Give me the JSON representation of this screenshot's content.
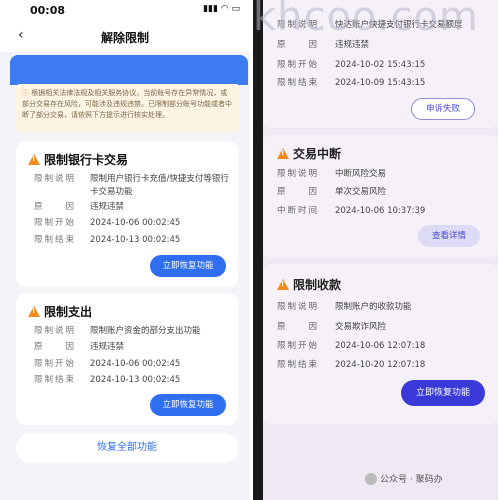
{
  "left": {
    "status_time": "00:08",
    "nav_title": "解除限制",
    "back_icon": "‹",
    "notice": "根据相关法律法规及相关服务协议，当前账号存在异常情况，或部分交易存在风险，可能涉及违规违禁。已限制部分账号功能或者中断了部分交易，请依照下方提示进行核实处理。",
    "card1": {
      "title": "限制银行卡交易",
      "rows": [
        {
          "k": "限制说明",
          "v": "限制用户银行卡充值/快捷支付等银行"
        },
        {
          "k": "",
          "v": "卡交易功能"
        },
        {
          "k": "原　　因",
          "v": "违规违禁"
        },
        {
          "k": "限制开始",
          "v": "2024-10-06 00:02:45"
        },
        {
          "k": "限制结束",
          "v": "2024-10-13 00:02:45"
        }
      ],
      "button": "立即恢复功能"
    },
    "card2": {
      "title": "限制支出",
      "rows": [
        {
          "k": "限制说明",
          "v": "限制账户资金的部分支出功能"
        },
        {
          "k": "原　　因",
          "v": "违规违禁"
        },
        {
          "k": "限制开始",
          "v": "2024-10-06 00:02:45"
        },
        {
          "k": "限制结束",
          "v": "2024-10-13 00:02:45"
        }
      ],
      "button": "立即恢复功能"
    },
    "restore_all": "恢复全部功能"
  },
  "right": {
    "watermark": "khcoo.com",
    "top_card": {
      "rows": [
        {
          "k": "限制说明",
          "v": "快达账户快捷支付银行卡交易额度"
        },
        {
          "k": "原　　因",
          "v": "违规违禁"
        },
        {
          "k": "限制开始",
          "v": "2024-10-02 15:43:15"
        },
        {
          "k": "限制结束",
          "v": "2024-10-09 15:43:15"
        }
      ],
      "button": "申诉失败"
    },
    "card_mid": {
      "title": "交易中断",
      "rows": [
        {
          "k": "限制说明",
          "v": "中断风险交易"
        },
        {
          "k": "原　　因",
          "v": "单次交易风险"
        },
        {
          "k": "中断时间",
          "v": "2024-10-06 10:37:39"
        }
      ],
      "button": "查看详情"
    },
    "card_bottom": {
      "title": "限制收款",
      "rows": [
        {
          "k": "限制说明",
          "v": "限制账户的收款功能"
        },
        {
          "k": "原　　因",
          "v": "交易欺诈风险"
        },
        {
          "k": "限制开始",
          "v": "2024-10-06 12:07:18"
        },
        {
          "k": "限制结束",
          "v": "2024-10-20 12:07:18"
        }
      ],
      "button": "立即恢复功能"
    },
    "footer": "公众号 · 聚码办"
  }
}
